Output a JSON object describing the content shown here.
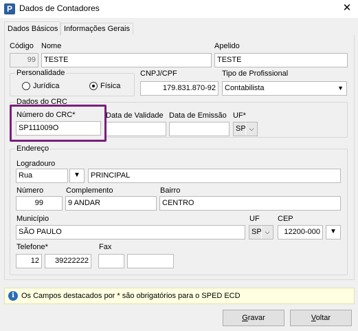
{
  "window": {
    "title": "Dados de Contadores",
    "app_icon_letter": "P"
  },
  "tabs": [
    {
      "label": "Dados Básicos",
      "active": true
    },
    {
      "label": "Informações Gerais",
      "active": false
    }
  ],
  "codigo": {
    "label": "Código",
    "value": "99"
  },
  "nome": {
    "label": "Nome",
    "value": "TESTE"
  },
  "apelido": {
    "label": "Apelido",
    "value": "TESTE"
  },
  "personalidade": {
    "label": "Personalidade",
    "options": [
      {
        "label": "Jurídica",
        "selected": false
      },
      {
        "label": "Física",
        "selected": true
      }
    ]
  },
  "cnpj": {
    "label": "CNPJ/CPF",
    "value": "179.831.870-92"
  },
  "tipo_profissional": {
    "label": "Tipo de Profissional",
    "value": "Contabilista"
  },
  "crc": {
    "group_label": "Dados do CRC",
    "numero_label": "Número do CRC*",
    "numero_value": "SP111009O",
    "validade_label": "Data de Validade",
    "validade_value": "",
    "emissao_label": "Data de Emissão",
    "emissao_value": "",
    "uf_label": "UF*",
    "uf_value": "SP"
  },
  "endereco": {
    "group_label": "Endereço",
    "logradouro_label": "Logradouro",
    "logradouro_tipo": "Rua",
    "logradouro_value": "PRINCIPAL",
    "numero_label": "Número",
    "numero_value": "99",
    "complemento_label": "Complemento",
    "complemento_value": "9 ANDAR",
    "bairro_label": "Bairro",
    "bairro_value": "CENTRO",
    "municipio_label": "Município",
    "municipio_value": "SÃO PAULO",
    "uf_label": "UF",
    "uf_value": "SP",
    "cep_label": "CEP",
    "cep_value": "12200-000",
    "telefone_label": "Telefone*",
    "telefone_ddd": "12",
    "telefone_numero": "39222222",
    "fax_label": "Fax",
    "fax_ddd": "",
    "fax_numero": ""
  },
  "info": {
    "text": "Os Campos destacados por * são obrigatórios para o SPED ECD"
  },
  "buttons": {
    "gravar_first": "G",
    "gravar_rest": "ravar",
    "voltar_first": "V",
    "voltar_rest": "oltar"
  },
  "colors": {
    "highlight": "#7a1f7a",
    "info_bg": "#ffffe1",
    "info_icon": "#2a6db8"
  }
}
